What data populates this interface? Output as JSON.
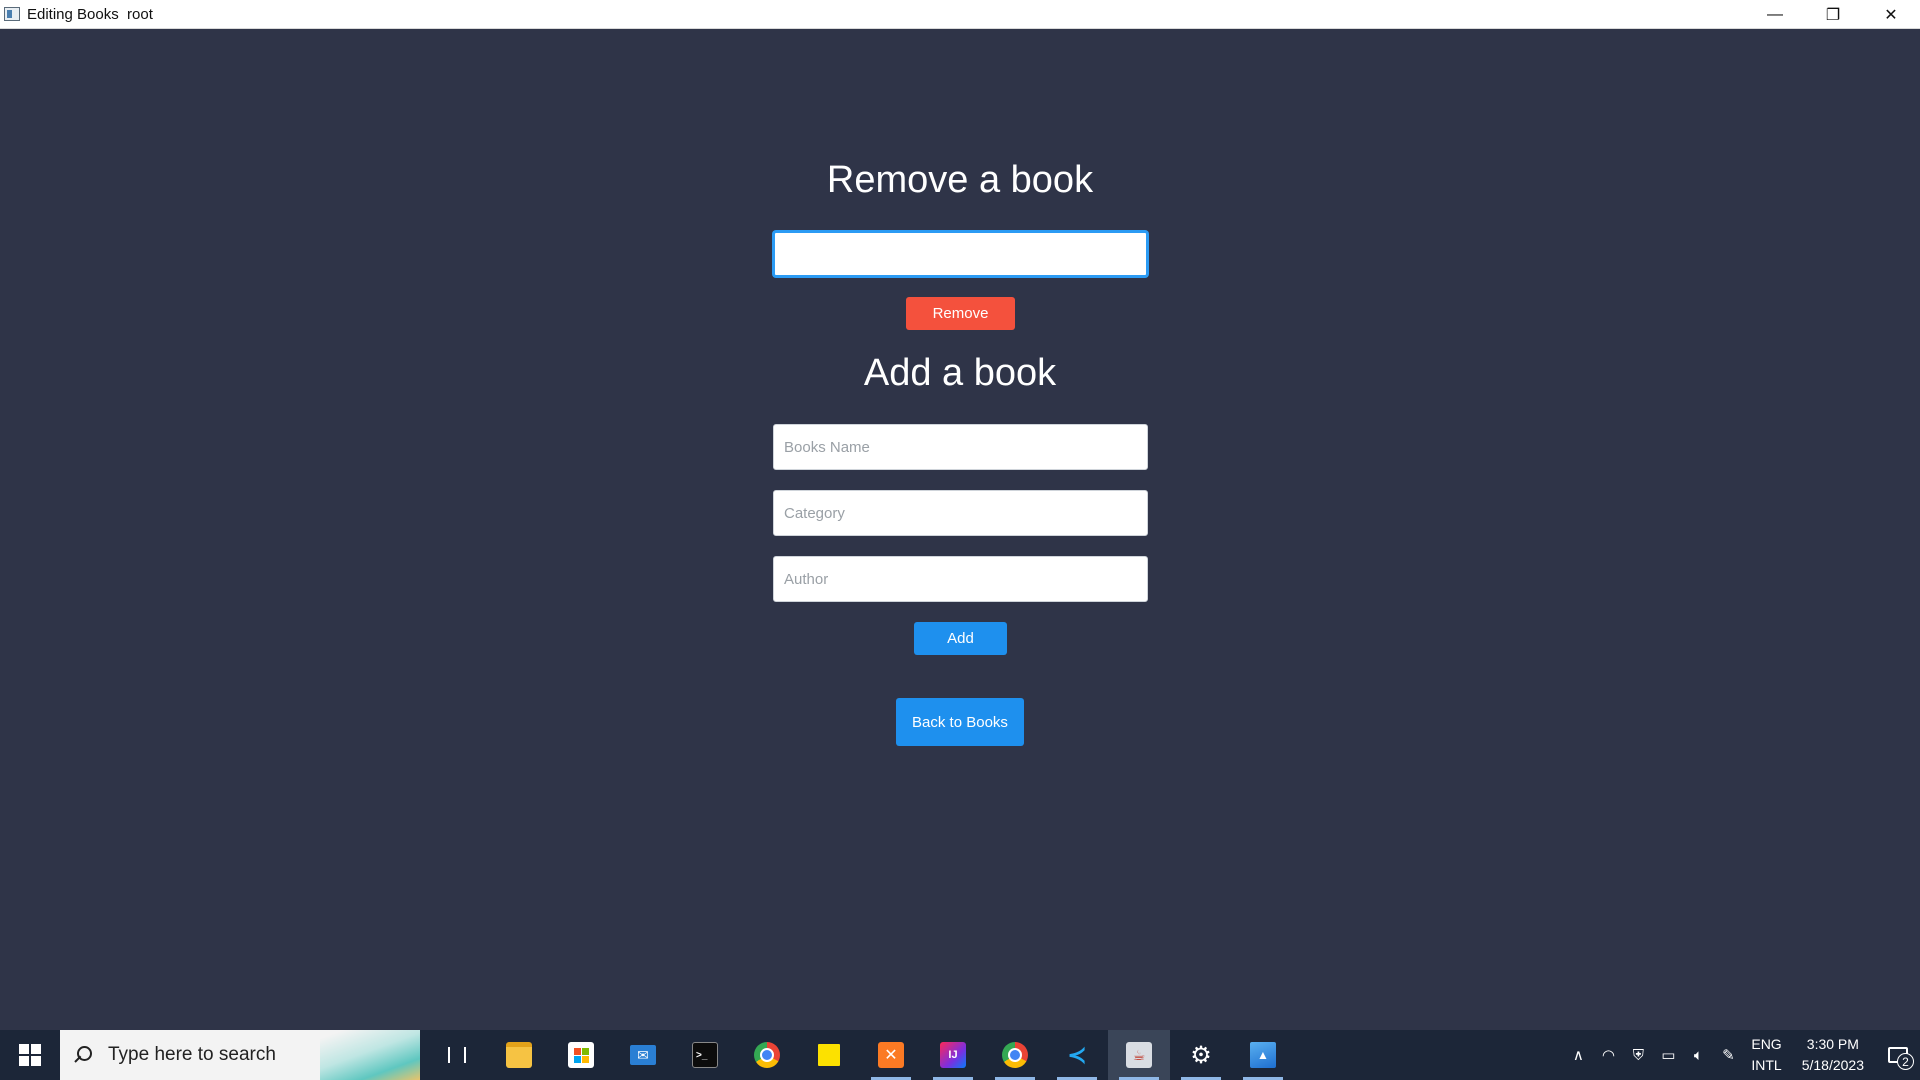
{
  "window": {
    "title": "Editing Books  root",
    "minimize_glyph": "—",
    "maximize_glyph": "❐",
    "close_glyph": "✕"
  },
  "remove_section": {
    "heading": "Remove a book",
    "input_value": "",
    "button_label": "Remove"
  },
  "add_section": {
    "heading": "Add a book",
    "name_placeholder": "Books Name",
    "category_placeholder": "Category",
    "author_placeholder": "Author",
    "button_label": "Add"
  },
  "back_button_label": "Back to Books",
  "colors": {
    "background": "#2f3448",
    "remove_button": "#f4513d",
    "primary_button": "#1e90ee",
    "focus_border": "#2b9bf4"
  },
  "taskbar": {
    "search_placeholder": "Type here to search",
    "apps": [
      {
        "icon": "task-view-icon"
      },
      {
        "icon": "file-explorer-icon"
      },
      {
        "icon": "microsoft-store-icon"
      },
      {
        "icon": "mail-icon"
      },
      {
        "icon": "terminal-icon"
      },
      {
        "icon": "chrome-icon"
      },
      {
        "icon": "sticky-notes-icon"
      },
      {
        "icon": "xampp-icon"
      },
      {
        "icon": "intellij-icon"
      },
      {
        "icon": "chrome-icon"
      },
      {
        "icon": "vscode-icon"
      },
      {
        "icon": "java-app-icon"
      },
      {
        "icon": "settings-icon"
      },
      {
        "icon": "photos-icon"
      }
    ],
    "tray": {
      "language_top": "ENG",
      "language_bottom": "INTL",
      "time": "3:30 PM",
      "date": "5/18/2023",
      "notification_count": "2"
    }
  }
}
